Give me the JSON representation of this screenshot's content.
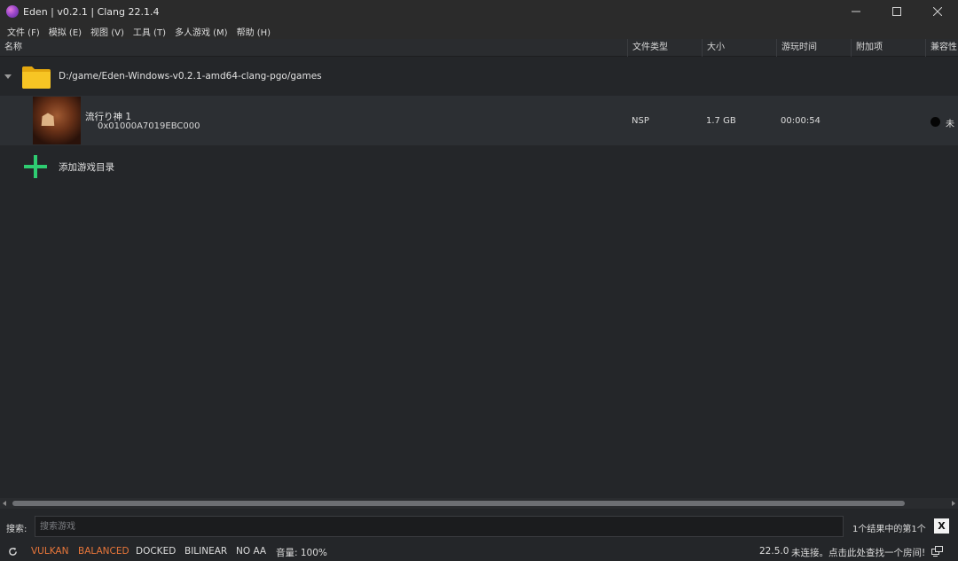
{
  "window": {
    "title": "Eden | v0.2.1 | Clang 22.1.4",
    "minimize_glyph": "—",
    "maximize_glyph": "☐",
    "close_glyph": "✕"
  },
  "menu": [
    {
      "label": "文件 (F)"
    },
    {
      "label": "模拟 (E)"
    },
    {
      "label": "视图 (V)"
    },
    {
      "label": "工具 (T)"
    },
    {
      "label": "多人游戏 (M)"
    },
    {
      "label": "帮助 (H)"
    }
  ],
  "columns": {
    "name": "名称",
    "file_type": "文件类型",
    "size": "大小",
    "play_time": "游玩时间",
    "addons": "附加项",
    "compat": "兼容性"
  },
  "folder": {
    "path": "D:/game/Eden-Windows-v0.2.1-amd64-clang-pgo/games",
    "icon": "folder-icon"
  },
  "game": {
    "title": "流行り神 1",
    "id": "0x01000A7019EBC000",
    "file_type": "NSP",
    "size": "1.7 GB",
    "play_time": "00:00:54",
    "compat": "未"
  },
  "add_dir": {
    "label": "添加游戏目录"
  },
  "search": {
    "label": "搜索:",
    "placeholder": "搜索游戏",
    "result": "1个结果中的第1个",
    "clear_label": "X"
  },
  "status": {
    "renderer": "VULKAN",
    "gpu_mode": "BALANCED",
    "dock": "DOCKED",
    "filter": "BILINEAR",
    "aa": "NO AA",
    "volume": "音量: 100%",
    "version": "22.5.0",
    "network": "未连接。点击此处查找一个房间!"
  },
  "colors": {
    "accent_orange": "#e8763a",
    "add_green": "#2ecc71",
    "folder_yellow": "#f5c518"
  }
}
